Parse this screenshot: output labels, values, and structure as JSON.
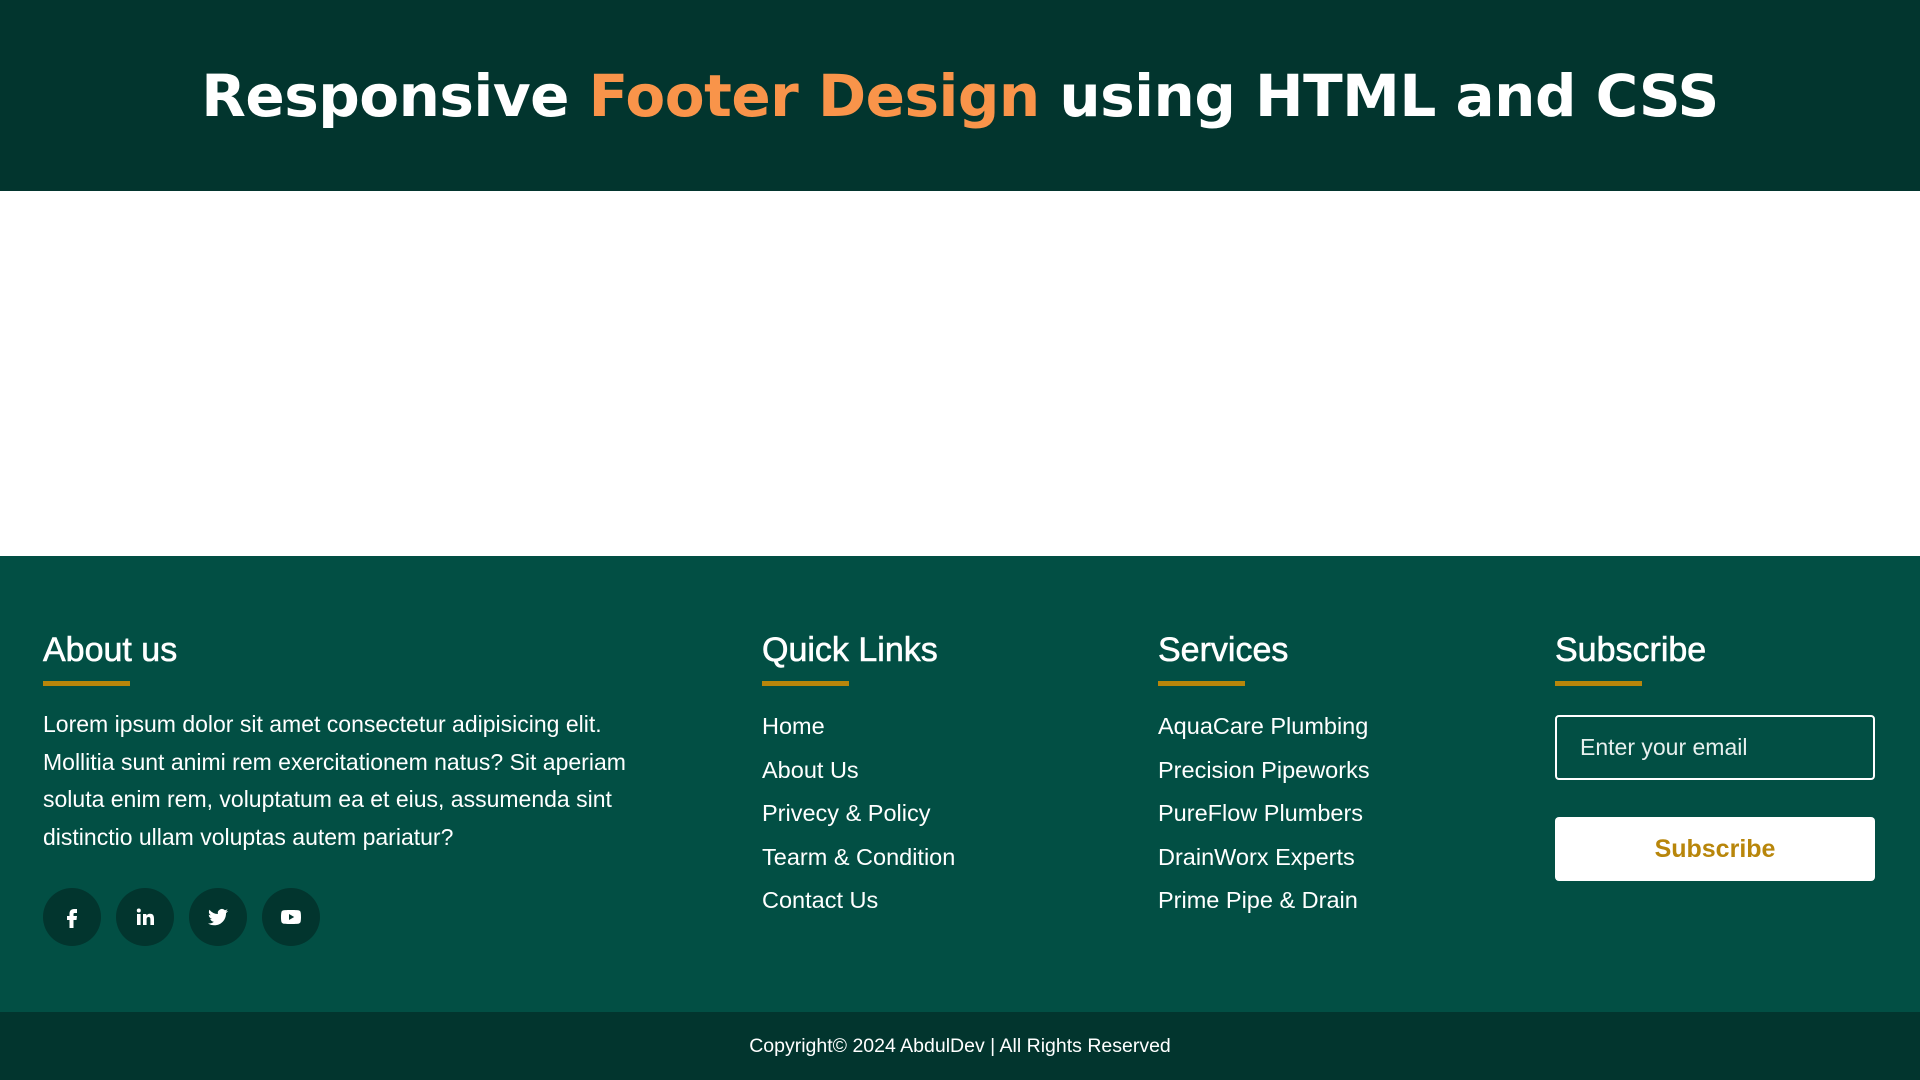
{
  "header": {
    "title_before": "Responsive ",
    "title_accent": "Footer Design",
    "title_after": " using HTML and CSS",
    "accent_color": "#f9944a"
  },
  "footer": {
    "about": {
      "heading": "About us",
      "text": "Lorem ipsum dolor sit amet consectetur adipisicing elit. Mollitia sunt animi rem exercitationem natus? Sit aperiam soluta enim rem, voluptatum ea et eius, assumenda sint distinctio ullam voluptas autem pariatur?",
      "socials": [
        {
          "name": "facebook",
          "icon": "facebook-icon"
        },
        {
          "name": "linkedin",
          "icon": "linkedin-icon"
        },
        {
          "name": "twitter",
          "icon": "twitter-icon"
        },
        {
          "name": "youtube",
          "icon": "youtube-icon"
        }
      ]
    },
    "quick_links": {
      "heading": "Quick Links",
      "items": [
        "Home",
        "About Us",
        "Privecy & Policy",
        "Tearm & Condition",
        "Contact Us"
      ]
    },
    "services": {
      "heading": "Services",
      "items": [
        "AquaCare Plumbing",
        "Precision Pipeworks",
        "PureFlow Plumbers",
        "DrainWorx Experts",
        "Prime Pipe & Drain"
      ]
    },
    "subscribe": {
      "heading": "Subscribe",
      "email_placeholder": "Enter your email",
      "email_value": "",
      "button_label": "Subscribe"
    }
  },
  "bottom_bar": {
    "copyright": "Copyright© 2024 AbdulDev | All Rights Reserved"
  },
  "colors": {
    "header_bg": "#02352e",
    "footer_bg": "#024f44",
    "accent_gold": "#b8860b",
    "title_orange": "#f9944a"
  }
}
